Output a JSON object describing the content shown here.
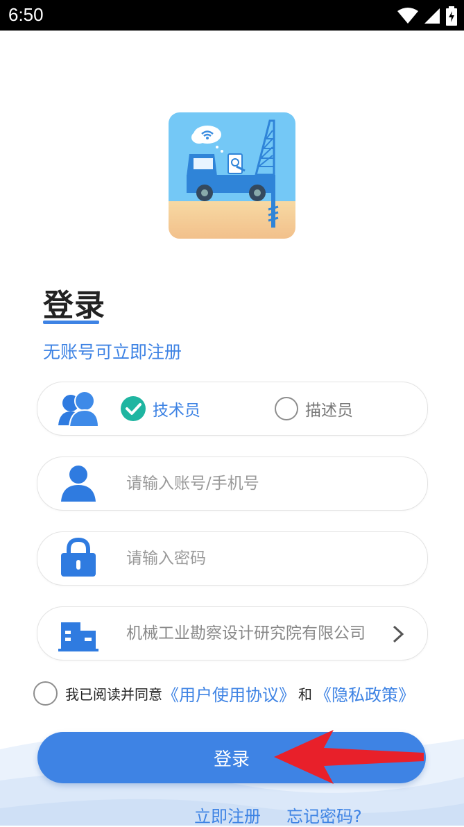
{
  "status_bar": {
    "time": "6:50"
  },
  "login": {
    "title": "登录",
    "register_prompt": "无账号可立即注册",
    "roles": [
      {
        "label": "技术员",
        "selected": true
      },
      {
        "label": "描述员",
        "selected": false
      }
    ],
    "account_placeholder": "请输入账号/手机号",
    "password_placeholder": "请输入密码",
    "company": "机械工业勘察设计研究院有限公司",
    "agreement": {
      "prefix": "我已阅读并同意",
      "user_agreement": "《用户使用协议》",
      "and": "和",
      "privacy_policy": "《隐私政策》",
      "checked": false
    },
    "login_button": "登录",
    "register_link": "立即注册",
    "forgot_password": "忘记密码?"
  },
  "colors": {
    "accent": "#3e83e4",
    "check": "#1fb5a1",
    "arrow": "#e8202a"
  },
  "icons": [
    "wifi-icon",
    "signal-icon",
    "battery-icon",
    "app-logo",
    "users-icon",
    "check-icon",
    "user-icon",
    "lock-icon",
    "building-icon",
    "chevron-right-icon",
    "arrow-annotation"
  ]
}
